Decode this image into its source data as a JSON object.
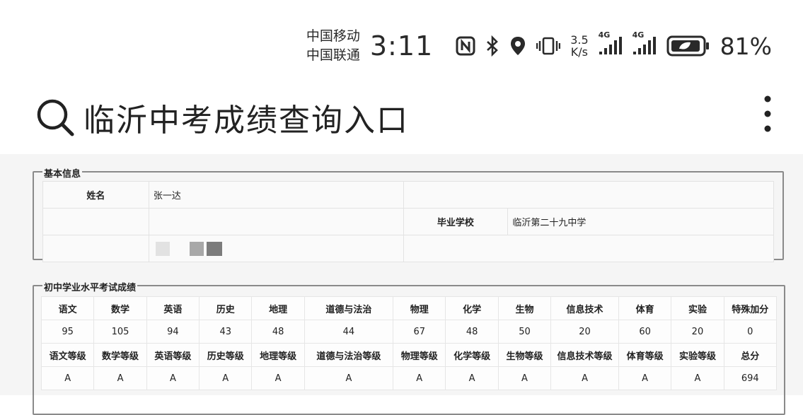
{
  "status_bar": {
    "carrier_1": "中国移动",
    "carrier_2": "中国联通",
    "time": "3:11",
    "speed_value": "3.5",
    "speed_unit": "K/s",
    "signal_1_label": "4G",
    "signal_2_label": "4G",
    "battery_percent": "81%",
    "icons": [
      "nfc-icon",
      "bluetooth-icon",
      "location-icon",
      "vibrate-icon",
      "signal-icon",
      "signal-icon",
      "battery-icon"
    ]
  },
  "header": {
    "title": "临沂中考成绩查询入口",
    "icons": [
      "search-icon",
      "more-vert-icon"
    ]
  },
  "basic_info": {
    "legend": "基本信息",
    "name_label": "姓名",
    "name_value": "张一达",
    "school_label": "毕业学校",
    "school_value": "临沂第二十九中学"
  },
  "scores": {
    "legend": "初中学业水平考试成绩",
    "subjects": [
      "语文",
      "数学",
      "英语",
      "历史",
      "地理",
      "道德与法治",
      "物理",
      "化学",
      "生物",
      "信息技术",
      "体育",
      "实验",
      "特殊加分"
    ],
    "values": [
      "95",
      "105",
      "94",
      "43",
      "48",
      "44",
      "67",
      "48",
      "50",
      "20",
      "60",
      "20",
      "0"
    ],
    "grade_labels": [
      "语文等级",
      "数学等级",
      "英语等级",
      "历史等级",
      "地理等级",
      "道德与法治等级",
      "物理等级",
      "化学等级",
      "生物等级",
      "信息技术等级",
      "体育等级",
      "实验等级",
      "总分"
    ],
    "grades": [
      "A",
      "A",
      "A",
      "A",
      "A",
      "A",
      "A",
      "A",
      "A",
      "A",
      "A",
      "A",
      "694"
    ]
  }
}
